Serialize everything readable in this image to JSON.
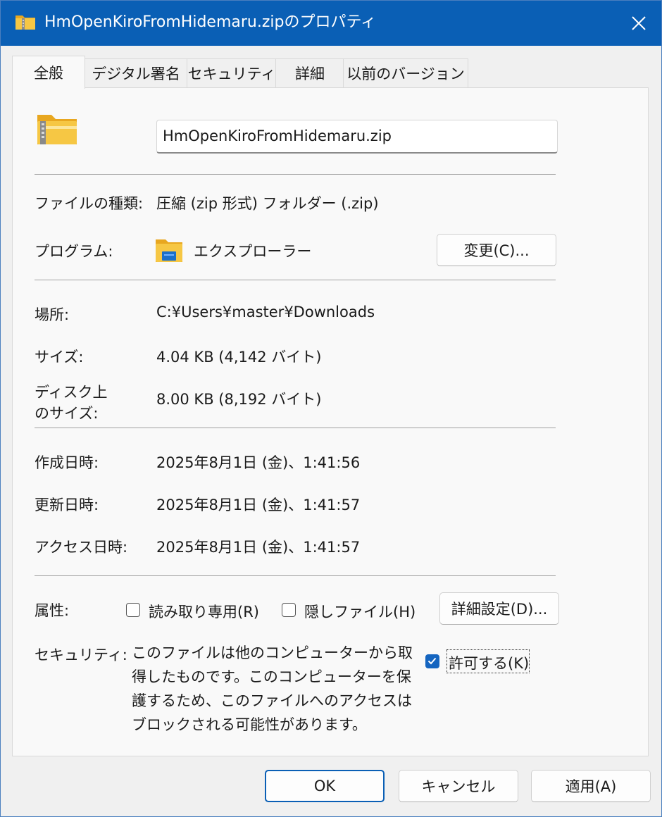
{
  "window": {
    "title": "HmOpenKiroFromHidemaru.zipのプロパティ"
  },
  "tabs": [
    {
      "label": "全般"
    },
    {
      "label": "デジタル署名"
    },
    {
      "label": "セキュリティ"
    },
    {
      "label": "詳細"
    },
    {
      "label": "以前のバージョン"
    }
  ],
  "general": {
    "filename": "HmOpenKiroFromHidemaru.zip",
    "file_type_label": "ファイルの種類:",
    "file_type_value": "圧縮 (zip 形式) フォルダー (.zip)",
    "program_label": "プログラム:",
    "program_value": "エクスプローラー",
    "change_button": "変更(C)...",
    "location_label": "場所:",
    "location_value": "C:¥Users¥master¥Downloads",
    "size_label": "サイズ:",
    "size_value": "4.04 KB (4,142 バイト)",
    "disk_size_label_line1": "ディスク上",
    "disk_size_label_line2": "のサイズ:",
    "disk_size_value": "8.00 KB (8,192 バイト)",
    "created_label": "作成日時:",
    "created_value": "2025年8月1日 (金)、1:41:56",
    "modified_label": "更新日時:",
    "modified_value": "2025年8月1日 (金)、1:41:57",
    "accessed_label": "アクセス日時:",
    "accessed_value": "2025年8月1日 (金)、1:41:57",
    "attributes_label": "属性:",
    "readonly_label": "読み取り専用(R)",
    "readonly_checked": false,
    "hidden_label": "隠しファイル(H)",
    "hidden_checked": false,
    "advanced_button": "詳細設定(D)...",
    "security_label": "セキュリティ:",
    "security_text": "このファイルは他のコンピューターから取得したものです。このコンピューターを保護するため、このファイルへのアクセスはブロックされる可能性があります。",
    "unblock_label": "許可する(K)",
    "unblock_checked": true
  },
  "footer": {
    "ok": "OK",
    "cancel": "キャンセル",
    "apply": "適用(A)"
  },
  "colors": {
    "titlebar": "#0a5fb5",
    "accent": "#1565c0",
    "folder": "#f5c542"
  },
  "icons": {
    "title": "zip-folder-icon",
    "file": "zip-folder-icon",
    "program": "explorer-icon",
    "close": "close-icon",
    "check": "check-icon"
  }
}
